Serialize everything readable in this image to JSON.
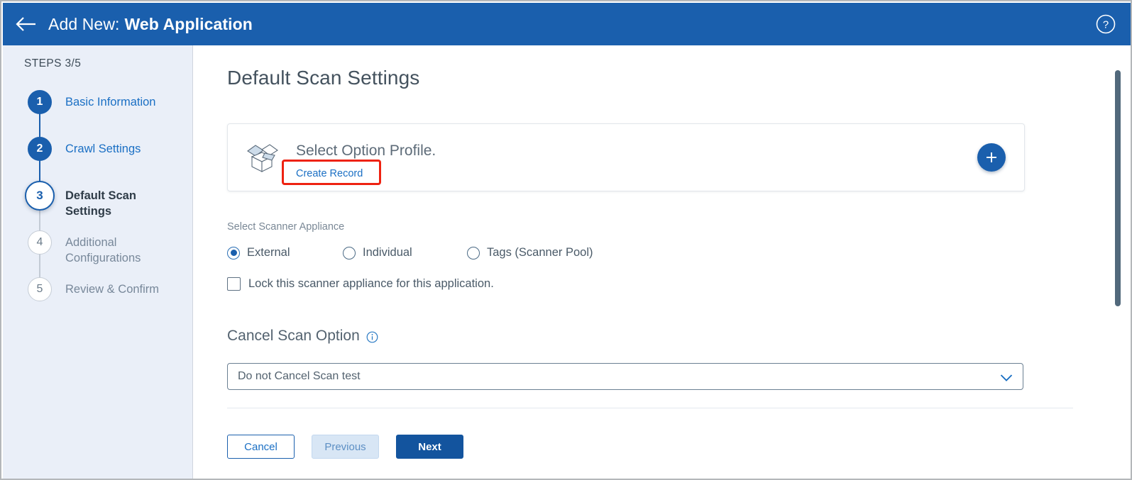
{
  "header": {
    "back_icon": "arrow-left-icon",
    "prefix": "Add New:",
    "title": "Web Application",
    "help_icon": "help-circle-icon"
  },
  "sidebar": {
    "steps_label": "STEPS 3/5",
    "steps": [
      {
        "number": "1",
        "label": "Basic Information",
        "state": "done"
      },
      {
        "number": "2",
        "label": "Crawl Settings",
        "state": "done"
      },
      {
        "number": "3",
        "label": "Default Scan Settings",
        "state": "current"
      },
      {
        "number": "4",
        "label": "Additional Configurations",
        "state": "upcoming"
      },
      {
        "number": "5",
        "label": "Review & Confirm",
        "state": "upcoming"
      }
    ]
  },
  "main": {
    "page_title": "Default Scan Settings",
    "profile_card": {
      "icon": "open-box-icon",
      "heading": "Select Option Profile.",
      "create_link": "Create Record",
      "add_button_icon": "plus-icon"
    },
    "scanner": {
      "label": "Select Scanner Appliance",
      "options": [
        {
          "label": "External",
          "selected": true
        },
        {
          "label": "Individual",
          "selected": false
        },
        {
          "label": "Tags (Scanner Pool)",
          "selected": false
        }
      ],
      "lock_checkbox": {
        "label": "Lock this scanner appliance for this application.",
        "checked": false
      }
    },
    "cancel_scan": {
      "label": "Cancel Scan Option",
      "info_icon": "info-circle-icon",
      "selected_value": "Do not Cancel Scan test",
      "chevron_icon": "chevron-down-icon"
    },
    "buttons": {
      "cancel": "Cancel",
      "previous": "Previous",
      "next": "Next"
    }
  },
  "colors": {
    "header_blue": "#1a5fad",
    "primary_blue": "#13549e",
    "link_blue": "#1a6fc4",
    "sidebar_bg": "#eaeff8",
    "annotation_red": "#ee2211"
  }
}
